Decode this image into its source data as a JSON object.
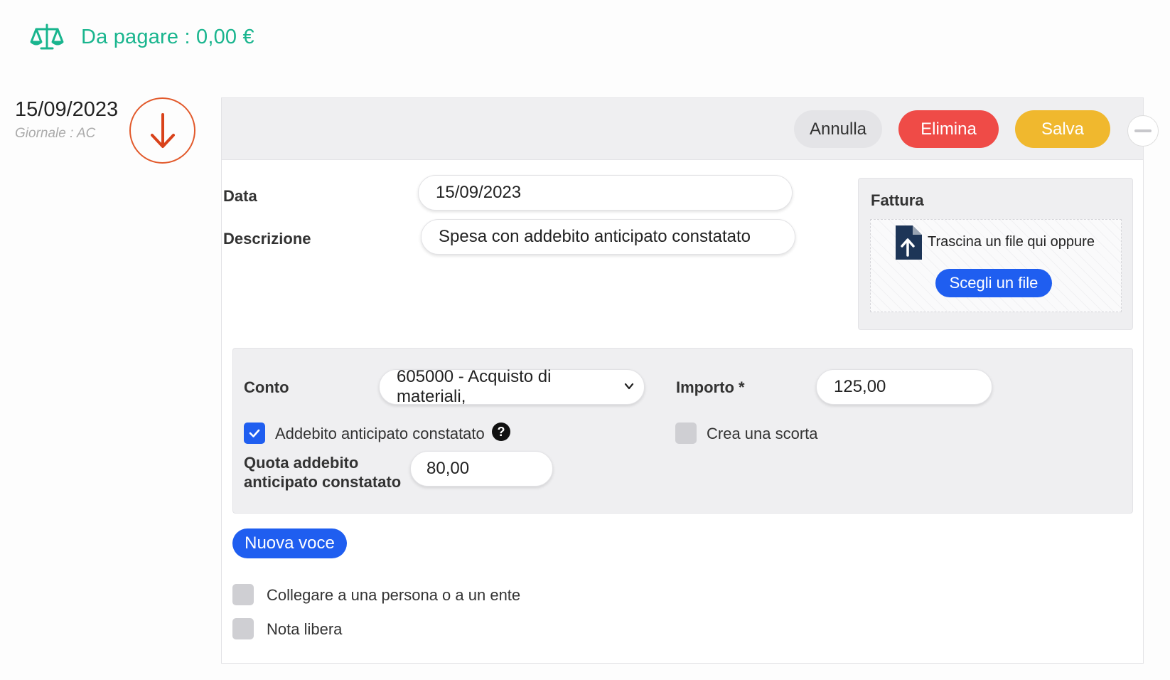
{
  "balance": {
    "text": "Da pagare : 0,00 €",
    "icon": "scales-icon",
    "color": "#19b58e"
  },
  "entry": {
    "date": "15/09/2023",
    "journal": "Giornale : AC",
    "direction_icon": "arrow-down-icon",
    "direction_color": "#e25a2c"
  },
  "toolbar": {
    "cancel_label": "Annulla",
    "delete_label": "Elimina",
    "save_label": "Salva",
    "collapse_icon": "minus-icon"
  },
  "form": {
    "date_label": "Data",
    "date_value": "15/09/2023",
    "description_label": "Descrizione",
    "description_value": "Spesa con addebito anticipato constatato"
  },
  "invoice": {
    "title": "Fattura",
    "drop_text": "Trascina un file qui oppure",
    "choose_label": "Scegli un file",
    "icon": "file-upload-icon"
  },
  "line": {
    "account_label": "Conto",
    "account_value": "605000 - Acquisto di materiali,",
    "amount_label": "Importo *",
    "amount_value": "125,00",
    "prepaid_label": "Addebito anticipato constatato",
    "prepaid_checked": true,
    "help_glyph": "?",
    "stock_label": "Crea una scorta",
    "stock_checked": false,
    "quota_label_line1": "Quota addebito",
    "quota_label_line2": "anticipato constatato",
    "quota_value": "80,00"
  },
  "new_line_label": "Nuova voce",
  "options": {
    "link_label": "Collegare a una persona o a un ente",
    "note_label": "Nota libera"
  },
  "colors": {
    "primary": "#1f5ef0",
    "danger": "#ef4b47",
    "warning": "#f0b82e"
  }
}
